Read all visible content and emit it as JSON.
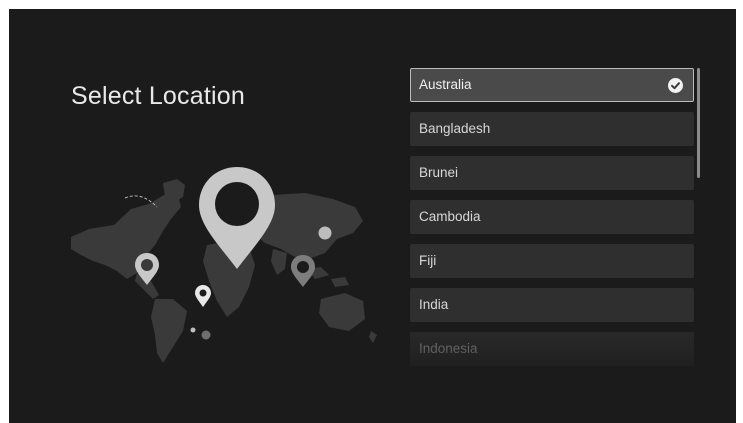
{
  "page": {
    "title": "Select Location"
  },
  "locations": {
    "items": [
      {
        "label": "Australia",
        "selected": true
      },
      {
        "label": "Bangladesh",
        "selected": false
      },
      {
        "label": "Brunei",
        "selected": false
      },
      {
        "label": "Cambodia",
        "selected": false
      },
      {
        "label": "Fiji",
        "selected": false
      },
      {
        "label": "India",
        "selected": false
      },
      {
        "label": "Indonesia",
        "selected": false
      }
    ]
  },
  "icons": {
    "selected_indicator": "check-circle-icon",
    "illustration": "world-map-with-location-pins"
  },
  "colors": {
    "background": "#1b1b1b",
    "item_background": "#2f2f2f",
    "selected_background": "#4a4a4a",
    "selected_border": "#bdbdbd",
    "text": "#d8d8d8",
    "pin": "#c8c8c8"
  }
}
